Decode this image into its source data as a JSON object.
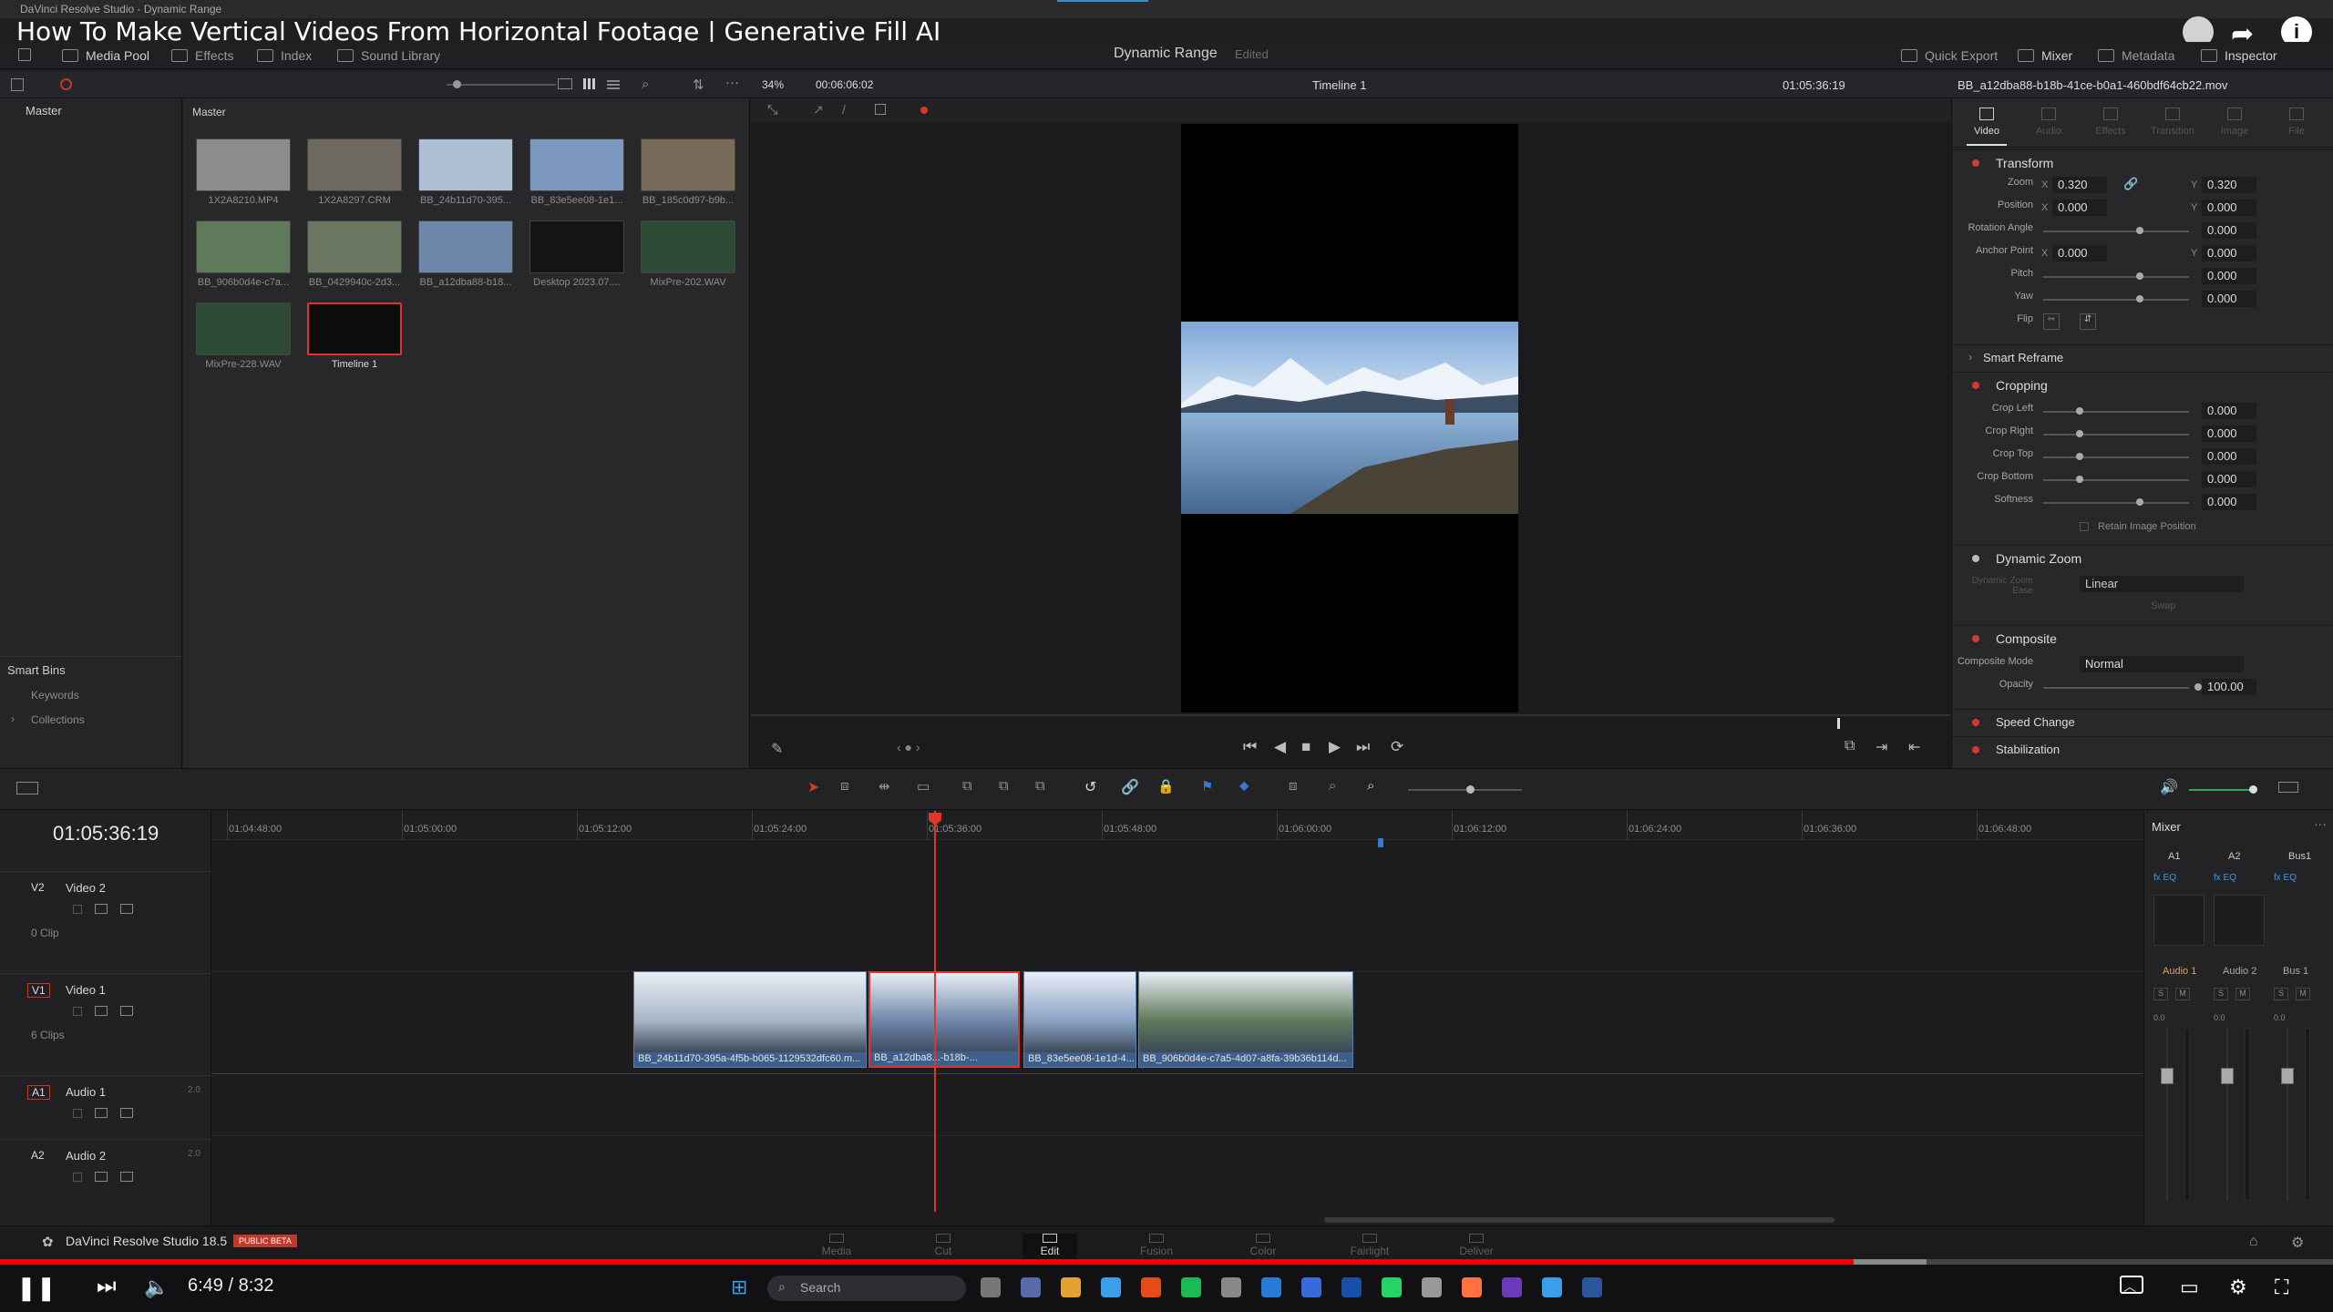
{
  "window": {
    "title": "DaVinci Resolve Studio - Dynamic Range"
  },
  "video": {
    "title": "How To Make Vertical Videos From Horizontal Footage | Generative Fill AI",
    "time": "6:49 / 8:32",
    "progress": 0.81
  },
  "toolbar": {
    "media_pool": "Media Pool",
    "effects": "Effects",
    "index": "Index",
    "sound_library": "Sound Library",
    "project": "Dynamic Range",
    "edited": "Edited",
    "quick_export": "Quick Export",
    "mixer": "Mixer",
    "metadata": "Metadata",
    "inspector": "Inspector"
  },
  "viewer": {
    "zoom": "34%",
    "duration": "00:06:06:02",
    "timeline": "Timeline 1",
    "timecode": "01:05:36:19",
    "clipname": "BB_a12dba88-b18b-41ce-b0a1-460bdf64cb22.mov"
  },
  "bins": {
    "master": "Master",
    "smart_bins": "Smart Bins",
    "keywords": "Keywords",
    "collections": "Collections",
    "pool_header": "Master"
  },
  "media": [
    {
      "name": "1X2A8210.MP4",
      "color": "#8c8c8a"
    },
    {
      "name": "1X2A8297.CRM",
      "color": "#6d6860"
    },
    {
      "name": "BB_24b11d70-395...",
      "color": "#aebfd6"
    },
    {
      "name": "BB_83e5ee08-1e1...",
      "color": "#7d99bf"
    },
    {
      "name": "BB_185c0d97-b9b...",
      "color": "#7a6a5a"
    },
    {
      "name": "BB_906b0d4e-c7a...",
      "color": "#5f7a5a"
    },
    {
      "name": "BB_0429940c-2d3...",
      "color": "#6b7660"
    },
    {
      "name": "BB_a12dba88-b18...",
      "color": "#6d86aa"
    },
    {
      "name": "Desktop 2023.07....",
      "color": "#151515"
    },
    {
      "name": "MixPre-202.WAV",
      "color": "#2c4a34"
    },
    {
      "name": "MixPre-228.WAV",
      "color": "#2c4a34"
    },
    {
      "name": "Timeline 1",
      "color": "#0d0d0d"
    }
  ],
  "inspector": {
    "tabs": [
      "Video",
      "Audio",
      "Effects",
      "Transition",
      "Image",
      "File"
    ],
    "transform": "Transform",
    "zoom_label": "Zoom",
    "zoom_x": "0.320",
    "zoom_y": "0.320",
    "position_label": "Position",
    "pos_x": "0.000",
    "pos_y": "0.000",
    "rotation_label": "Rotation Angle",
    "rotation": "0.000",
    "anchor_label": "Anchor Point",
    "anchor_x": "0.000",
    "anchor_y": "0.000",
    "pitch_label": "Pitch",
    "pitch": "0.000",
    "yaw_label": "Yaw",
    "yaw": "0.000",
    "flip_label": "Flip",
    "smart_reframe": "Smart Reframe",
    "cropping": "Cropping",
    "crop_left_label": "Crop Left",
    "crop_left": "0.000",
    "crop_right_label": "Crop Right",
    "crop_right": "0.000",
    "crop_top_label": "Crop Top",
    "crop_top": "0.000",
    "crop_bottom_label": "Crop Bottom",
    "crop_bottom": "0.000",
    "softness_label": "Softness",
    "softness": "0.000",
    "retain": "Retain Image Position",
    "dynamic_zoom": "Dynamic Zoom",
    "dz_ease_label": "Dynamic Zoom Ease",
    "dz_ease": "Linear",
    "swap": "Swap",
    "composite": "Composite",
    "comp_mode_label": "Composite Mode",
    "comp_mode": "Normal",
    "opacity_label": "Opacity",
    "opacity": "100.00",
    "speed_change": "Speed Change",
    "stabilization": "Stabilization"
  },
  "timeline": {
    "timecode": "01:05:36:19",
    "ruler": [
      "01:04:48:00",
      "01:05:00:00",
      "01:05:12:00",
      "01:05:24:00",
      "01:05:36:00",
      "01:05:48:00",
      "01:06:00:00",
      "01:06:12:00",
      "01:06:24:00",
      "01:06:36:00",
      "01:06:48:00"
    ],
    "tracks": [
      {
        "id": "V2",
        "name": "Video 2",
        "sub": "0 Clip"
      },
      {
        "id": "V1",
        "name": "Video 1",
        "sub": "6 Clips"
      },
      {
        "id": "A1",
        "name": "Audio 1",
        "sub": "2.0"
      },
      {
        "id": "A2",
        "name": "Audio 2",
        "sub": "2.0"
      }
    ],
    "clips": [
      "BB_24b11d70-395a-4f5b-b065-1129532dfc60.m...",
      "BB_a12dba8...-b18b-...",
      "BB_83e5ee08-1e1d-4...",
      "BB_906b0d4e-c7a5-4d07-a8fa-39b36b114d..."
    ]
  },
  "mixer": {
    "title": "Mixer",
    "channels": [
      "A1",
      "A2",
      "Bus1"
    ],
    "names": [
      "Audio 1",
      "Audio 2",
      "Bus 1"
    ],
    "db": "0.0"
  },
  "pages": {
    "app": "DaVinci Resolve Studio 18.5",
    "beta": "PUBLIC BETA",
    "items": [
      "Media",
      "Cut",
      "Edit",
      "Fusion",
      "Color",
      "Fairlight",
      "Deliver"
    ]
  },
  "taskbar": {
    "search": "Search"
  }
}
